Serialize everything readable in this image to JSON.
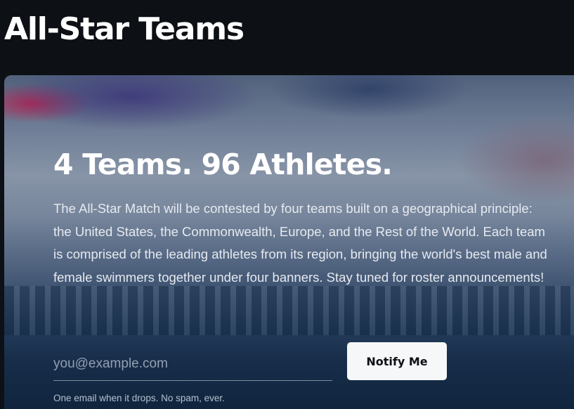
{
  "header": {
    "title": "All-Star Teams"
  },
  "hero": {
    "title": "4 Teams. 96 Athletes.",
    "body": "The All-Star Match will be contested by four teams built on a geographical principle: the United States, the Commonwealth, Europe, and the Rest of the World. Each team is comprised of the leading athletes from its region, bringing the world's best male and female swimmers together under four banners. Stay tuned for roster announcements!",
    "background_image": "swimming-splash-photo"
  },
  "signup": {
    "email_placeholder": "you@example.com",
    "email_value": "",
    "button_label": "Notify Me",
    "fine_print": "One email when it drops. No spam, ever."
  },
  "colors": {
    "page_background": "#0d1014",
    "button_background": "#f6f7f9",
    "button_text": "#0c0f14",
    "heading_text": "#ffffff"
  }
}
